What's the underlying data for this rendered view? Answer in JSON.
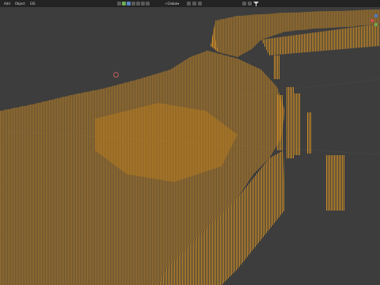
{
  "menu": {
    "items": [
      "Add",
      "Object",
      "GIS"
    ]
  },
  "header": {
    "transform_orientation": "Global"
  },
  "icons": {
    "select_mode": "select-box-icon",
    "cursor": "cursor-icon",
    "move": "move-icon",
    "rotate": "rotate-icon",
    "scale": "scale-icon",
    "transform": "transform-icon",
    "pivot": "pivot-icon",
    "snap": "magnet-icon",
    "proportional": "proportional-edit-icon",
    "filter": "filter-icon"
  },
  "colors": {
    "background": "#3d3d3d",
    "header": "#232323",
    "wireframe": "#f5a623",
    "wireframe_dark": "#c97f14",
    "active_tool": "#5a86c8",
    "axis_x": "#d94b4b",
    "axis_y": "#6fae54",
    "axis_z": "#4a7fd4"
  }
}
